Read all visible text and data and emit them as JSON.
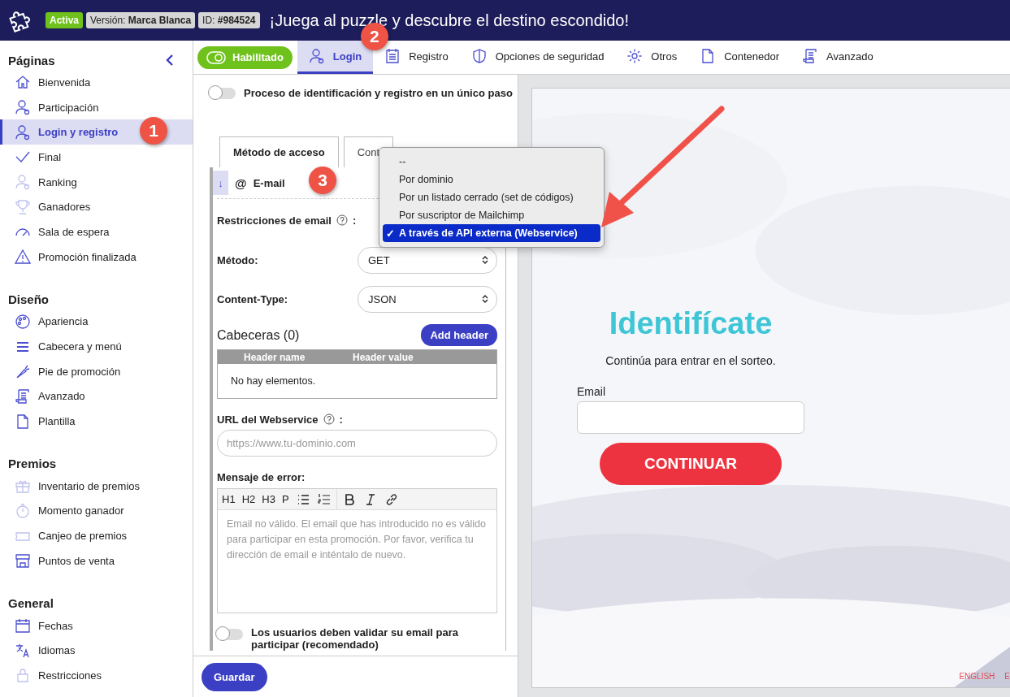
{
  "header": {
    "status_badge": "Activa",
    "version_badge": "Versión: **Marca Blanca**",
    "id_badge": "ID: **#984524**",
    "title": "¡Juega al puzzle y descubre el destino escondido!"
  },
  "sidebar": {
    "sections": [
      {
        "title": "Páginas",
        "items": [
          {
            "label": "Bienvenida",
            "selected": false
          },
          {
            "label": "Participación",
            "selected": false
          },
          {
            "label": "Login y registro",
            "selected": true,
            "marker": "1"
          },
          {
            "label": "Final",
            "selected": false
          },
          {
            "label": "Ranking",
            "selected": false
          },
          {
            "label": "Ganadores",
            "selected": false
          },
          {
            "label": "Sala de espera",
            "selected": false
          },
          {
            "label": "Promoción finalizada",
            "selected": false
          }
        ]
      },
      {
        "title": "Diseño",
        "items": [
          {
            "label": "Apariencia",
            "selected": false
          },
          {
            "label": "Cabecera y menú",
            "selected": false
          },
          {
            "label": "Pie de promoción",
            "selected": false
          },
          {
            "label": "Avanzado",
            "selected": false
          },
          {
            "label": "Plantilla",
            "selected": false
          }
        ]
      },
      {
        "title": "Premios",
        "items": [
          {
            "label": "Inventario de premios",
            "selected": false
          },
          {
            "label": "Momento ganador",
            "selected": false
          },
          {
            "label": "Canjeo de premios",
            "selected": false
          },
          {
            "label": "Puntos de venta",
            "selected": false
          }
        ]
      },
      {
        "title": "General",
        "items": [
          {
            "label": "Fechas",
            "selected": false
          },
          {
            "label": "Idiomas",
            "selected": false
          },
          {
            "label": "Restricciones",
            "selected": false
          }
        ]
      }
    ]
  },
  "toolbar": {
    "enabled_button": "Habilitado",
    "tabs": [
      {
        "label": "Login",
        "selected": true,
        "marker": "2"
      },
      {
        "label": "Registro",
        "selected": false
      },
      {
        "label": "Opciones de seguridad",
        "selected": false
      },
      {
        "label": "Otros",
        "selected": false
      },
      {
        "label": "Contenedor",
        "selected": false
      },
      {
        "label": "Avanzado",
        "selected": false
      }
    ]
  },
  "form": {
    "single_step_toggle": {
      "label": "Proceso de identificación y registro en un único paso",
      "on": false
    },
    "inner_tabs": [
      {
        "label": "Método de acceso",
        "selected": true
      },
      {
        "label": "Cont",
        "selected": false
      }
    ],
    "method": {
      "toggle": "↓",
      "symbol": "@",
      "label": "E-mail",
      "marker": "3"
    },
    "restrictions": {
      "label": "Restricciones de email",
      "suffix": ":"
    },
    "http_method": {
      "label": "Método:",
      "value": "GET"
    },
    "content_type": {
      "label": "Content-Type:",
      "value": "JSON"
    },
    "headers": {
      "title": "Cabeceras (0)",
      "add_button": "Add header",
      "columns": [
        "Header name",
        "Header value"
      ],
      "empty": "No hay elementos."
    },
    "url": {
      "label": "URL del Webservice",
      "suffix": ":",
      "placeholder": "https://www.tu-dominio.com"
    },
    "error_message": {
      "label": "Mensaje de error:",
      "toolbar": [
        "H1",
        "H2",
        "H3",
        "P"
      ],
      "placeholder": "Email no válido. El email que has introducido no es válido para participar en esta promoción. Por favor, verifica tu dirección de email e inténtalo de nuevo."
    },
    "validate_toggle": {
      "label": "Los usuarios deben validar su email para participar (recomendado)",
      "on": false
    },
    "save_button": "Guardar"
  },
  "dropdown": {
    "options": [
      {
        "label": "--",
        "selected": false
      },
      {
        "label": "Por dominio",
        "selected": false
      },
      {
        "label": "Por un listado cerrado (set de códigos)",
        "selected": false
      },
      {
        "label": "Por suscriptor de Mailchimp",
        "selected": false
      },
      {
        "label": "A través de API externa (Webservice)",
        "selected": true,
        "check": "✓"
      }
    ]
  },
  "preview": {
    "heading": "Identifícate",
    "subtitle": "Continúa para entrar en el sorteo.",
    "email_label": "Email",
    "button": "CONTINUAR",
    "languages": [
      "ENGLISH",
      "E"
    ]
  }
}
